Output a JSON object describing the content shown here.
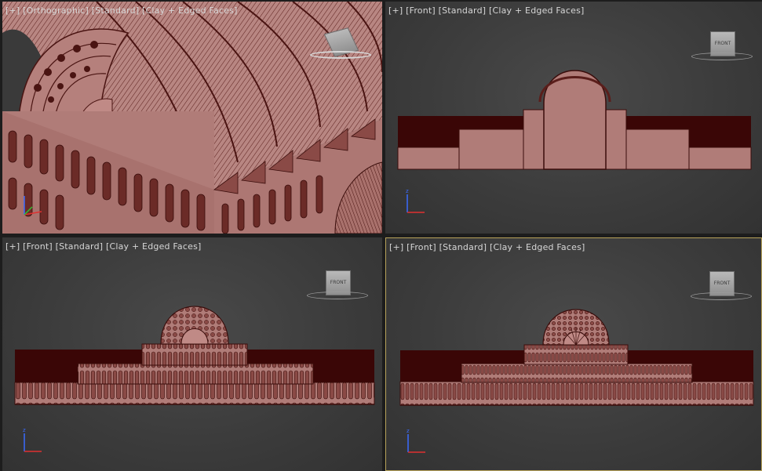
{
  "viewports": [
    {
      "id": "vp1",
      "labels": [
        "[+]",
        "[Orthographic]",
        "[Standard]",
        "[Clay + Edged Faces]"
      ],
      "viewcube": ""
    },
    {
      "id": "vp2",
      "labels": [
        "[+]",
        "[Front]",
        "[Standard]",
        "[Clay + Edged Faces]"
      ],
      "viewcube": "FRONT"
    },
    {
      "id": "vp3",
      "labels": [
        "[+]",
        "[Front]",
        "[Standard]",
        "[Clay + Edged Faces]"
      ],
      "viewcube": "FRONT"
    },
    {
      "id": "vp4",
      "labels": [
        "[+]",
        "[Front]",
        "[Standard]",
        "[Clay + Edged Faces]"
      ],
      "viewcube": "FRONT",
      "active": true
    }
  ],
  "axis": {
    "x": "x",
    "z": "z"
  },
  "colors": {
    "clay": "#b07c78",
    "clay_dark": "#6b2b27",
    "edge": "#3a0d0b",
    "backdrop": "#3a0606",
    "active_border": "#b8a35a"
  }
}
